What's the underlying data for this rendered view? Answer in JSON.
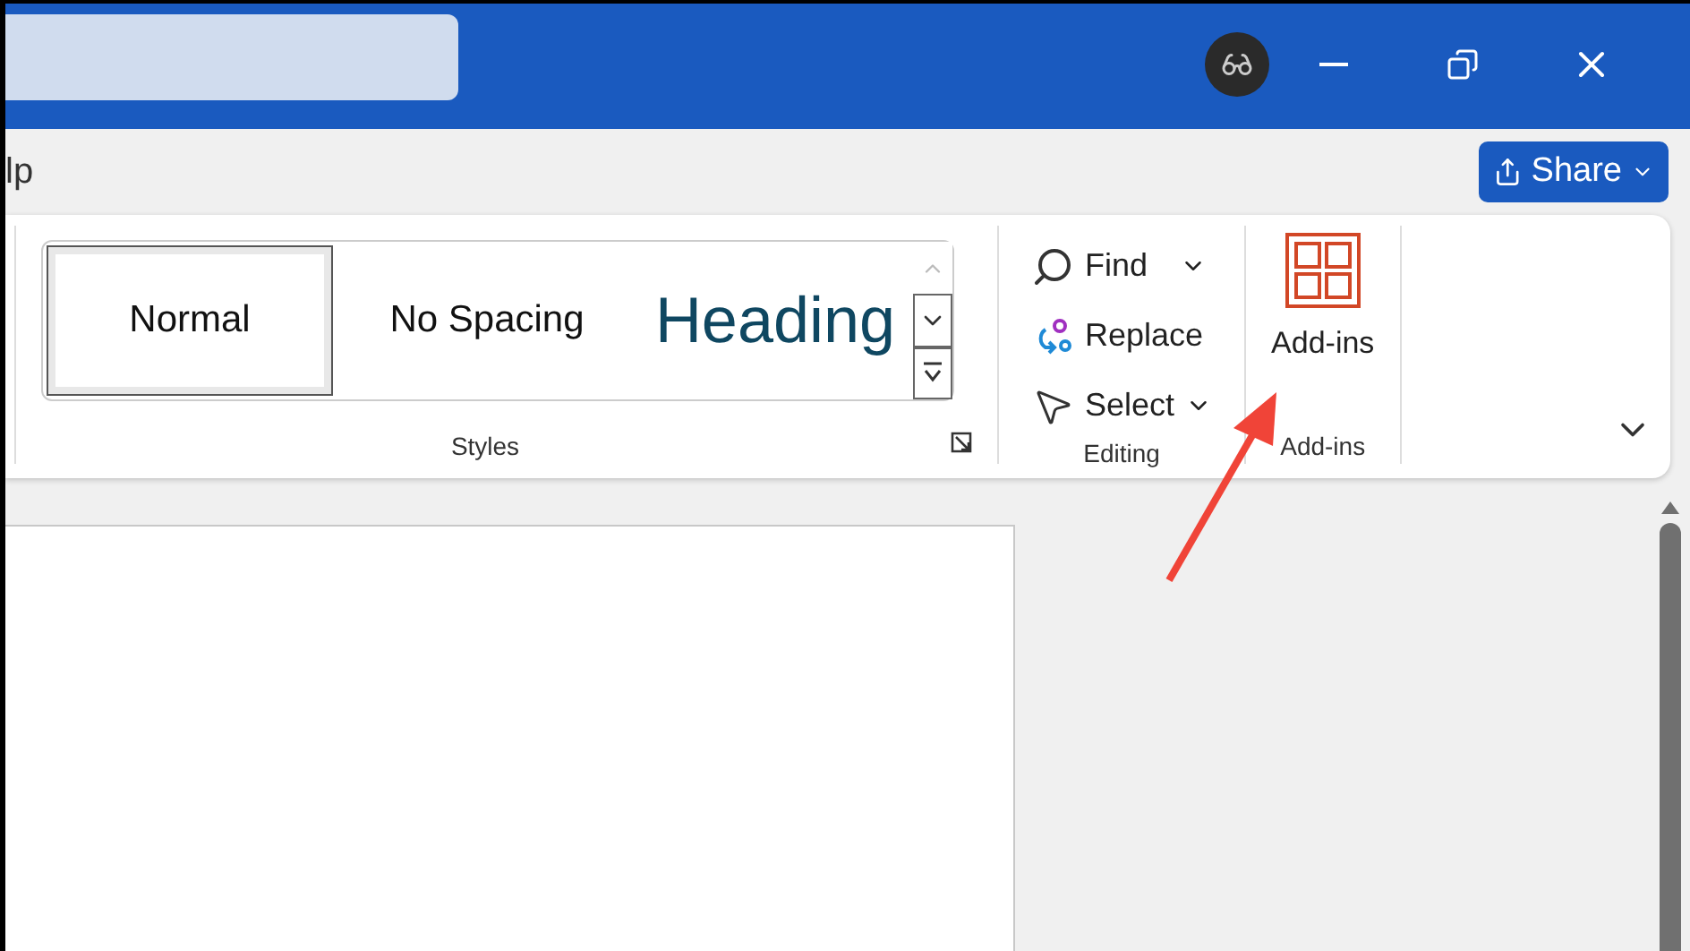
{
  "menu": {
    "tab_fragment": "lp"
  },
  "share_button": {
    "label": "Share"
  },
  "ribbon": {
    "styles": {
      "label": "Styles",
      "items": [
        {
          "label": "Normal",
          "kind": "body",
          "selected": true
        },
        {
          "label": "No Spacing",
          "kind": "body",
          "selected": false
        },
        {
          "label": "Heading",
          "kind": "heading",
          "selected": false
        }
      ]
    },
    "editing": {
      "label": "Editing",
      "items": [
        {
          "label": "Find",
          "kind": "find"
        },
        {
          "label": "Replace",
          "kind": "replace"
        },
        {
          "label": "Select",
          "kind": "select"
        }
      ]
    },
    "add_ins": {
      "label": "Add-ins",
      "button": "Add-ins"
    }
  }
}
